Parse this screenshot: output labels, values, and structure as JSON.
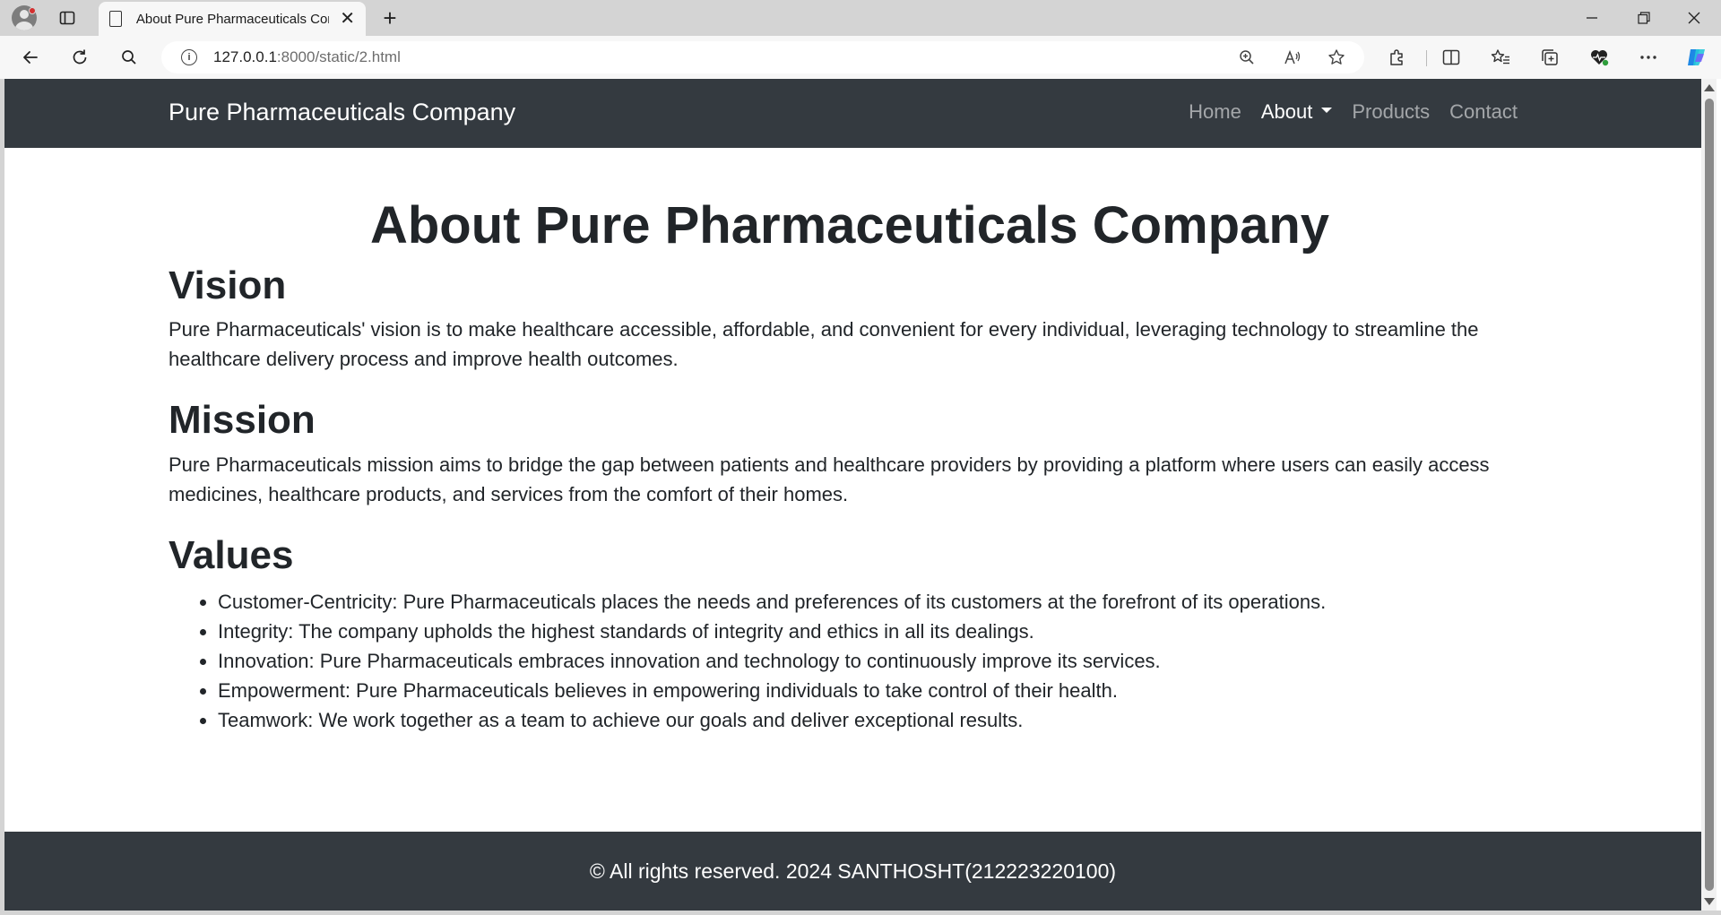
{
  "browser": {
    "tab_title": "About Pure Pharmaceuticals Company",
    "url_host": "127.0.0.1",
    "url_rest": ":8000/static/2.html",
    "new_tab_glyph": "+",
    "tab_close_glyph": "✕"
  },
  "navbar": {
    "brand": "Pure Pharmaceuticals Company",
    "links": [
      {
        "label": "Home",
        "active": false
      },
      {
        "label": "About",
        "active": true,
        "dropdown": true
      },
      {
        "label": "Products",
        "active": false
      },
      {
        "label": "Contact",
        "active": false
      }
    ]
  },
  "main": {
    "title": "About Pure Pharmaceuticals Company",
    "vision": {
      "heading": "Vision",
      "text": "Pure Pharmaceuticals' vision is to make healthcare accessible, affordable, and convenient for every individual, leveraging technology to streamline the healthcare delivery process and improve health outcomes."
    },
    "mission": {
      "heading": "Mission",
      "text": "Pure Pharmaceuticals mission aims to bridge the gap between patients and healthcare providers by providing a platform where users can easily access medicines, healthcare products, and services from the comfort of their homes."
    },
    "values": {
      "heading": "Values",
      "items": [
        "Customer-Centricity: Pure Pharmaceuticals places the needs and preferences of its customers at the forefront of its operations.",
        "Integrity: The company upholds the highest standards of integrity and ethics in all its dealings.",
        "Innovation: Pure Pharmaceuticals embraces innovation and technology to continuously improve its services.",
        "Empowerment: Pure Pharmaceuticals believes in empowering individuals to take control of their health.",
        "Teamwork: We work together as a team to achieve our goals and deliver exceptional results."
      ]
    }
  },
  "footer": {
    "text": "© All rights reserved. 2024 SANTHOSHT(212223220100)"
  },
  "colors": {
    "navbar_bg": "#343a40",
    "text": "#212529",
    "nav_link_muted": "rgba(255,255,255,0.55)"
  }
}
